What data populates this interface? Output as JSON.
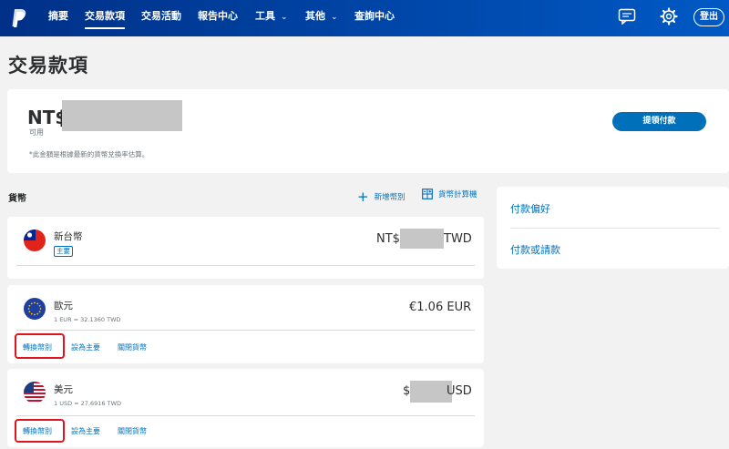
{
  "nav": {
    "items": [
      {
        "label": "摘要"
      },
      {
        "label": "交易款項"
      },
      {
        "label": "交易活動"
      },
      {
        "label": "報告中心"
      },
      {
        "label": "工具"
      },
      {
        "label": "其他"
      },
      {
        "label": "查詢中心"
      }
    ],
    "active": "交易款項",
    "logout_label": "登出",
    "icons": [
      "paypal-logo",
      "message-center-icon",
      "gear-icon"
    ]
  },
  "page": {
    "title": "交易款項"
  },
  "balance": {
    "prefix": "NT$",
    "label": "可用",
    "note": "*此金額是根據最新的貨幣兌換率估算。",
    "withdraw_label": "提領付款"
  },
  "currencies": {
    "heading": "貨幣",
    "add_label": "新增幣別",
    "calculator_label": "貨幣計算機",
    "list": [
      {
        "name": "新台幣",
        "badge": "主要",
        "amount_prefix": "NT$",
        "amount_suffix": "TWD",
        "flag": "taiwan-flag"
      },
      {
        "name": "歐元",
        "rate": "1 EUR = 32.1360 TWD",
        "amount": "€1.06 EUR",
        "flag": "eu-flag",
        "actions": [
          "轉換幣別",
          "設為主要",
          "關閉貨幣"
        ]
      },
      {
        "name": "美元",
        "rate": "1 USD = 27.6916 TWD",
        "amount_prefix": "$",
        "amount_suffix": "USD",
        "flag": "us-flag",
        "actions": [
          "轉換幣別",
          "設為主要",
          "關閉貨幣"
        ]
      }
    ]
  },
  "side_panel": {
    "links": [
      {
        "label": "付款偏好"
      },
      {
        "label": "付款或請款"
      }
    ]
  },
  "colors": {
    "nav_start": "#003087",
    "nav_end": "#0059c4",
    "link": "#0070ba",
    "highlight": "#e0141e"
  }
}
